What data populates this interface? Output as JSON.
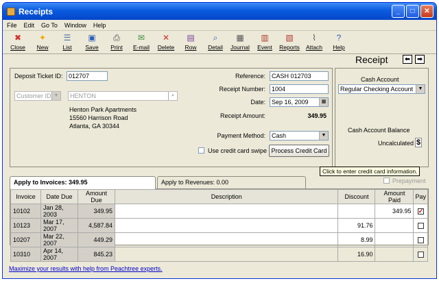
{
  "window": {
    "title": "Receipts"
  },
  "menu": [
    "File",
    "Edit",
    "Go To",
    "Window",
    "Help"
  ],
  "toolbar": [
    {
      "label": "Close",
      "icon": "close-icon",
      "glyph": "✖",
      "color": "#d32f2f"
    },
    {
      "label": "New",
      "icon": "new-icon",
      "glyph": "✦",
      "color": "#f1a800"
    },
    {
      "label": "List",
      "icon": "list-icon",
      "glyph": "☰",
      "color": "#4a6fa5"
    },
    {
      "label": "Save",
      "icon": "save-icon",
      "glyph": "▣",
      "color": "#2e5fb8"
    },
    {
      "label": "Print",
      "icon": "print-icon",
      "glyph": "⎙",
      "color": "#444444"
    },
    {
      "label": "E-mail",
      "icon": "email-icon",
      "glyph": "✉",
      "color": "#3b8d3b"
    },
    {
      "label": "Delete",
      "icon": "delete-icon",
      "glyph": "✕",
      "color": "#d32f2f"
    },
    {
      "label": "Row",
      "icon": "row-icon",
      "glyph": "▤",
      "color": "#7a3e9d"
    },
    {
      "label": "Detail",
      "icon": "detail-icon",
      "glyph": "⌕",
      "color": "#2e5fb8"
    },
    {
      "label": "Journal",
      "icon": "journal-icon",
      "glyph": "▦",
      "color": "#555555"
    },
    {
      "label": "Event",
      "icon": "event-icon",
      "glyph": "▥",
      "color": "#b03a2e"
    },
    {
      "label": "Reports",
      "icon": "reports-icon",
      "glyph": "▧",
      "color": "#b03a2e"
    },
    {
      "label": "Attach",
      "icon": "attach-icon",
      "glyph": "⌇",
      "color": "#555555"
    },
    {
      "label": "Help",
      "icon": "help-icon",
      "glyph": "?",
      "color": "#2e5fb8"
    }
  ],
  "header": {
    "title": "Receipt"
  },
  "form": {
    "deposit_label": "Deposit Ticket ID:",
    "deposit_value": "012707",
    "customer_placeholder": "Customer ID",
    "customer_value": "HENTON",
    "address": [
      "Henton Park Apartments",
      "15560 Harrison Road",
      "Atlanta, GA 30344"
    ],
    "reference_label": "Reference:",
    "reference_value": "CASH 012703",
    "receipt_number_label": "Receipt Number:",
    "receipt_number_value": "1004",
    "date_label": "Date:",
    "date_value": "Sep 16, 2009",
    "amount_label": "Receipt Amount:",
    "amount_value": "349.95",
    "payment_method_label": "Payment Method:",
    "payment_method_value": "Cash",
    "credit_swipe_label": "Use credit card swipe",
    "process_button": "Process Credit Card"
  },
  "cash_account": {
    "label": "Cash Account",
    "value": "Regular Checking Account",
    "balance_label": "Cash Account Balance",
    "balance_value": "Uncalculated"
  },
  "tooltip": "Click to enter credit card information.",
  "prepayment_label": "Prepayment",
  "tabs": {
    "invoices": "Apply to Invoices: 349.95",
    "revenues": "Apply to Revenues: 0.00"
  },
  "table": {
    "headers": [
      "Invoice",
      "Date Due",
      "Amount Due",
      "Description",
      "Discount",
      "Amount Paid",
      "Pay"
    ],
    "rows": [
      {
        "invoice": "10102",
        "date": "Jan 28, 2003",
        "amount": "349.95",
        "desc": "",
        "discount": "",
        "paid": "349.95",
        "pay": true
      },
      {
        "invoice": "10123",
        "date": "Mar 17, 2007",
        "amount": "4,587.84",
        "desc": "",
        "discount": "91.76",
        "paid": "",
        "pay": false
      },
      {
        "invoice": "10207",
        "date": "Mar 22, 2007",
        "amount": "449.29",
        "desc": "",
        "discount": "8.99",
        "paid": "",
        "pay": false
      },
      {
        "invoice": "10310",
        "date": "Apr 14, 2007",
        "amount": "845.23",
        "desc": "",
        "discount": "16.90",
        "paid": "",
        "pay": false
      }
    ]
  },
  "footer": {
    "link": "Maximize your results with help from Peachtree experts."
  }
}
